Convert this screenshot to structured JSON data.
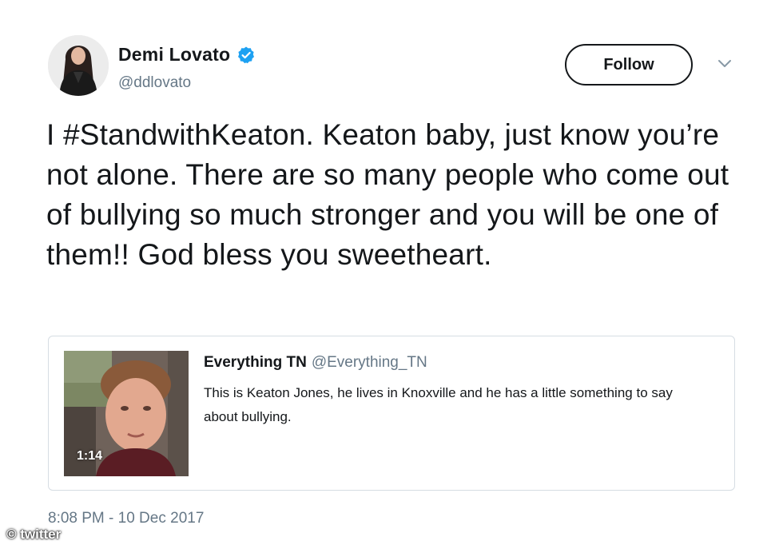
{
  "tweet": {
    "author": {
      "name": "Demi Lovato",
      "handle": "@ddlovato",
      "verified": true
    },
    "follow_label": "Follow",
    "text": "I #StandwithKeaton. Keaton baby, just know you’re not alone. There are so many people who come out of bullying so much stronger and you will be one of them!! God bless you sweetheart.",
    "quoted": {
      "name": "Everything TN",
      "handle": "@Everything_TN",
      "text": "This is Keaton Jones, he lives in Knoxville and he has a little something to say about bullying.",
      "video_duration": "1:14"
    },
    "timestamp": "8:08 PM - 10 Dec 2017"
  },
  "watermark": "© twitter",
  "colors": {
    "verified_blue": "#1da1f2",
    "text_primary": "#14171a",
    "text_secondary": "#657786",
    "border": "#d6dde3"
  },
  "icons": {
    "verified": "verified-badge-icon",
    "caret": "chevron-down-icon"
  }
}
